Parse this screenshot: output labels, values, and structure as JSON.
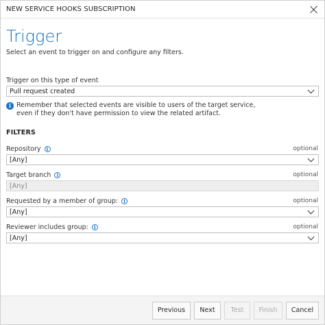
{
  "dialog": {
    "title": "NEW SERVICE HOOKS SUBSCRIPTION",
    "heading": "Trigger",
    "subtext": "Select an event to trigger on and configure any filters."
  },
  "event": {
    "label": "Trigger on this type of event",
    "value": "Pull request created"
  },
  "notice": {
    "line1": "Remember that selected events are visible to users of the target service,",
    "line2": "even if they don't have permission to view the related artifact."
  },
  "filters": {
    "heading": "FILTERS",
    "optional_text": "optional",
    "repository": {
      "label": "Repository",
      "value": "[Any]"
    },
    "target_branch": {
      "label": "Target branch",
      "value": "[Any]"
    },
    "requested_by": {
      "label": "Requested by a member of group:",
      "value": "[Any]"
    },
    "reviewer": {
      "label": "Reviewer includes group:",
      "value": "[Any]"
    }
  },
  "footer": {
    "previous": "Previous",
    "next": "Next",
    "test": "Test",
    "finish": "Finish",
    "cancel": "Cancel"
  }
}
